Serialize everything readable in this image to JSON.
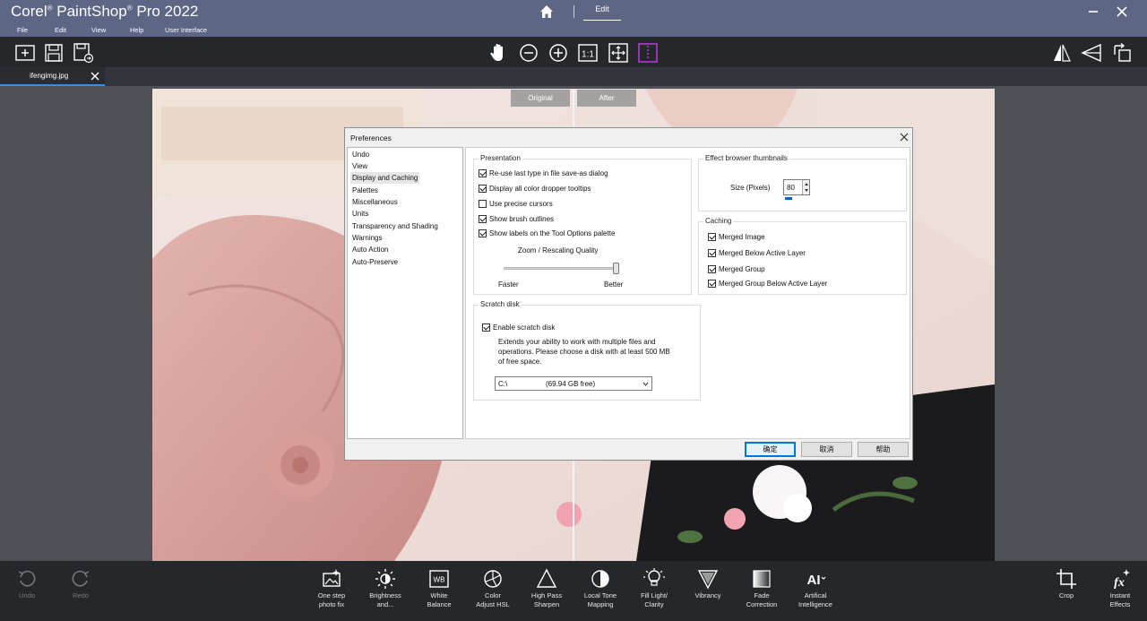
{
  "app": {
    "brand": "Corel",
    "reg": "®",
    "product": "PaintShop",
    "reg2": "®",
    "product2": "Pro 2022"
  },
  "modes": {
    "edit_label": "Edit"
  },
  "menu": [
    "File",
    "Edit",
    "View",
    "Help",
    "User Interface"
  ],
  "document_tab": {
    "name": "ifengimg.jpg"
  },
  "compare": {
    "original_label": "Original",
    "after_label": "After"
  },
  "dialog": {
    "title": "Preferences",
    "categories": [
      "Undo",
      "View",
      "Display and Caching",
      "Palettes",
      "Miscellaneous",
      "Units",
      "Transparency and Shading",
      "Warnings",
      "Auto Action",
      "Auto-Preserve"
    ],
    "selected_category": "Display and Caching",
    "presentation": {
      "title": "Presentation",
      "options": [
        {
          "label": "Re-use last type in file save-as dialog",
          "checked": true
        },
        {
          "label": "Display all color dropper tooltips",
          "checked": true
        },
        {
          "label": "Use precise cursors",
          "checked": false
        },
        {
          "label": "Show brush outlines",
          "checked": true
        },
        {
          "label": "Show labels on the Tool Options palette",
          "checked": true
        }
      ],
      "zoom_label": "Zoom / Rescaling Quality",
      "zoom_quality": 1.0,
      "faster_label": "Faster",
      "better_label": "Better"
    },
    "thumbnails": {
      "title": "Effect browser thumbnails",
      "size_label": "Size (Pixels)",
      "size_value": "80"
    },
    "caching": {
      "title": "Caching",
      "options": [
        {
          "label": "Merged Image",
          "checked": true
        },
        {
          "label": "Merged Below Active Layer",
          "checked": true
        },
        {
          "label": "Merged Group",
          "checked": true
        },
        {
          "label": "Merged Group Below Active Layer",
          "checked": true
        }
      ]
    },
    "scratch": {
      "title": "Scratch disk",
      "enable_label": "Enable scratch disk",
      "enable_checked": true,
      "desc1": "Extends your ability to work with multiple files and",
      "desc2": "operations. Please choose a disk with at least 500 MB",
      "desc3": "of free space.",
      "drive": "C:\\",
      "free": "(69.94 GB free)"
    },
    "buttons": {
      "ok": "确定",
      "cancel": "取消",
      "help": "帮助"
    }
  },
  "bottom": {
    "undo": "Undo",
    "redo": "Redo",
    "tools": [
      {
        "l1": "One step",
        "l2": "photo fix",
        "icon": "one-step-photo-fix-icon"
      },
      {
        "l1": "Brightness",
        "l2": "and...",
        "icon": "brightness-icon"
      },
      {
        "l1": "White",
        "l2": "Balance",
        "icon": "white-balance-icon"
      },
      {
        "l1": "Color",
        "l2": "Adjust HSL",
        "icon": "color-hsl-icon"
      },
      {
        "l1": "High Pass",
        "l2": "Sharpen",
        "icon": "high-pass-sharpen-icon"
      },
      {
        "l1": "Local Tone",
        "l2": "Mapping",
        "icon": "local-tone-mapping-icon"
      },
      {
        "l1": "Fill Light/",
        "l2": "Clarity",
        "icon": "fill-light-icon"
      },
      {
        "l1": "Vibrancy",
        "l2": "",
        "icon": "vibrancy-icon"
      },
      {
        "l1": "Fade",
        "l2": "Correction",
        "icon": "fade-correction-icon"
      },
      {
        "l1": "Artifical",
        "l2": "Intelligence",
        "icon": "ai-icon"
      }
    ],
    "crop": "Crop",
    "instant_l1": "Instant",
    "instant_l2": "Effects"
  },
  "colors": {
    "titlebar": "#5e6685",
    "toolbar": "#25272b",
    "accent_tab": "#3a8de0",
    "ok_border": "#0078d7"
  }
}
